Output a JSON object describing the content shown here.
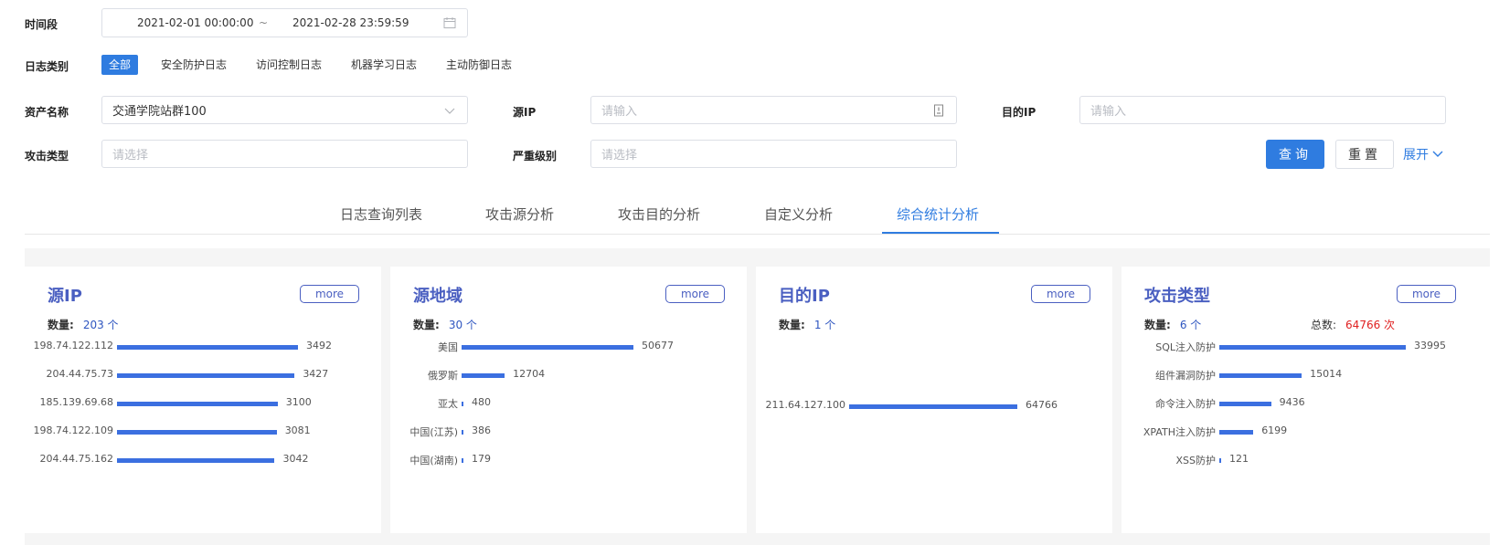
{
  "filters": {
    "time_label": "时间段",
    "date_start": "2021-02-01 00:00:00",
    "date_sep": "~",
    "date_end": "2021-02-28 23:59:59",
    "log_type_label": "日志类别",
    "log_types": [
      "全部",
      "安全防护日志",
      "访问控制日志",
      "机器学习日志",
      "主动防御日志"
    ],
    "asset_label": "资产名称",
    "asset_value": "交通学院站群100",
    "src_ip_label": "源IP",
    "src_ip_placeholder": "请输入",
    "dst_ip_label": "目的IP",
    "dst_ip_placeholder": "请输入",
    "attack_type_label": "攻击类型",
    "attack_type_placeholder": "请选择",
    "severity_label": "严重级别",
    "severity_placeholder": "请选择",
    "query_button": "查询",
    "reset_button": "重置",
    "expand_link": "展开"
  },
  "tabs": [
    "日志查询列表",
    "攻击源分析",
    "攻击目的分析",
    "自定义分析",
    "综合统计分析"
  ],
  "active_tab": 4,
  "colors": {
    "accent": "#2f7ce0",
    "title": "#4a5fc1",
    "bar": "#3b6fe0",
    "total": "#e02020"
  },
  "cards": [
    {
      "title": "源IP",
      "more": "more",
      "count_label": "数量:",
      "count_value": "203 个",
      "rows": [
        {
          "label": "198.74.122.112",
          "value": 3492
        },
        {
          "label": "204.44.75.73",
          "value": 3427
        },
        {
          "label": "185.139.69.68",
          "value": 3100
        },
        {
          "label": "198.74.122.109",
          "value": 3081
        },
        {
          "label": "204.44.75.162",
          "value": 3042
        }
      ]
    },
    {
      "title": "源地域",
      "more": "more",
      "count_label": "数量:",
      "count_value": "30 个",
      "rows": [
        {
          "label": "美国",
          "value": 50677
        },
        {
          "label": "俄罗斯",
          "value": 12704
        },
        {
          "label": "亚太",
          "value": 480
        },
        {
          "label": "中国(江苏)",
          "value": 386
        },
        {
          "label": "中国(湖南)",
          "value": 179
        }
      ]
    },
    {
      "title": "目的IP",
      "more": "more",
      "count_label": "数量:",
      "count_value": "1 个",
      "rows": [
        {
          "label": "211.64.127.100",
          "value": 64766
        }
      ]
    },
    {
      "title": "攻击类型",
      "more": "more",
      "count_label": "数量:",
      "count_value": "6 个",
      "total_label": "总数:",
      "total_value": "64766 次",
      "rows": [
        {
          "label": "SQL注入防护",
          "value": 33995
        },
        {
          "label": "组件漏洞防护",
          "value": 15014
        },
        {
          "label": "命令注入防护",
          "value": 9436
        },
        {
          "label": "XPATH注入防护",
          "value": 6199
        },
        {
          "label": "XSS防护",
          "value": 121
        }
      ]
    }
  ]
}
